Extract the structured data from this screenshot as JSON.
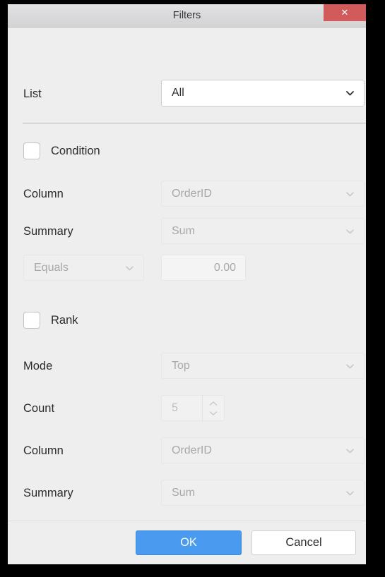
{
  "window": {
    "title": "Filters",
    "close_label": "✕"
  },
  "colors": {
    "close_button": "#d15a5a",
    "primary_button": "#4a9aef",
    "window_background": "#eeeeee",
    "titlebar_background": "#d9d9dc"
  },
  "list_section": {
    "label": "List",
    "value": "All"
  },
  "condition_section": {
    "checkbox_label": "Condition",
    "checked": false,
    "column": {
      "label": "Column",
      "value": "OrderID"
    },
    "summary": {
      "label": "Summary",
      "value": "Sum"
    },
    "operator": {
      "value": "Equals"
    },
    "amount": {
      "value": "0.00"
    }
  },
  "rank_section": {
    "checkbox_label": "Rank",
    "checked": false,
    "mode": {
      "label": "Mode",
      "value": "Top"
    },
    "count": {
      "label": "Count",
      "value": "5"
    },
    "column": {
      "label": "Column",
      "value": "OrderID"
    },
    "summary": {
      "label": "Summary",
      "value": "Sum"
    }
  },
  "footer": {
    "ok_label": "OK",
    "cancel_label": "Cancel"
  }
}
